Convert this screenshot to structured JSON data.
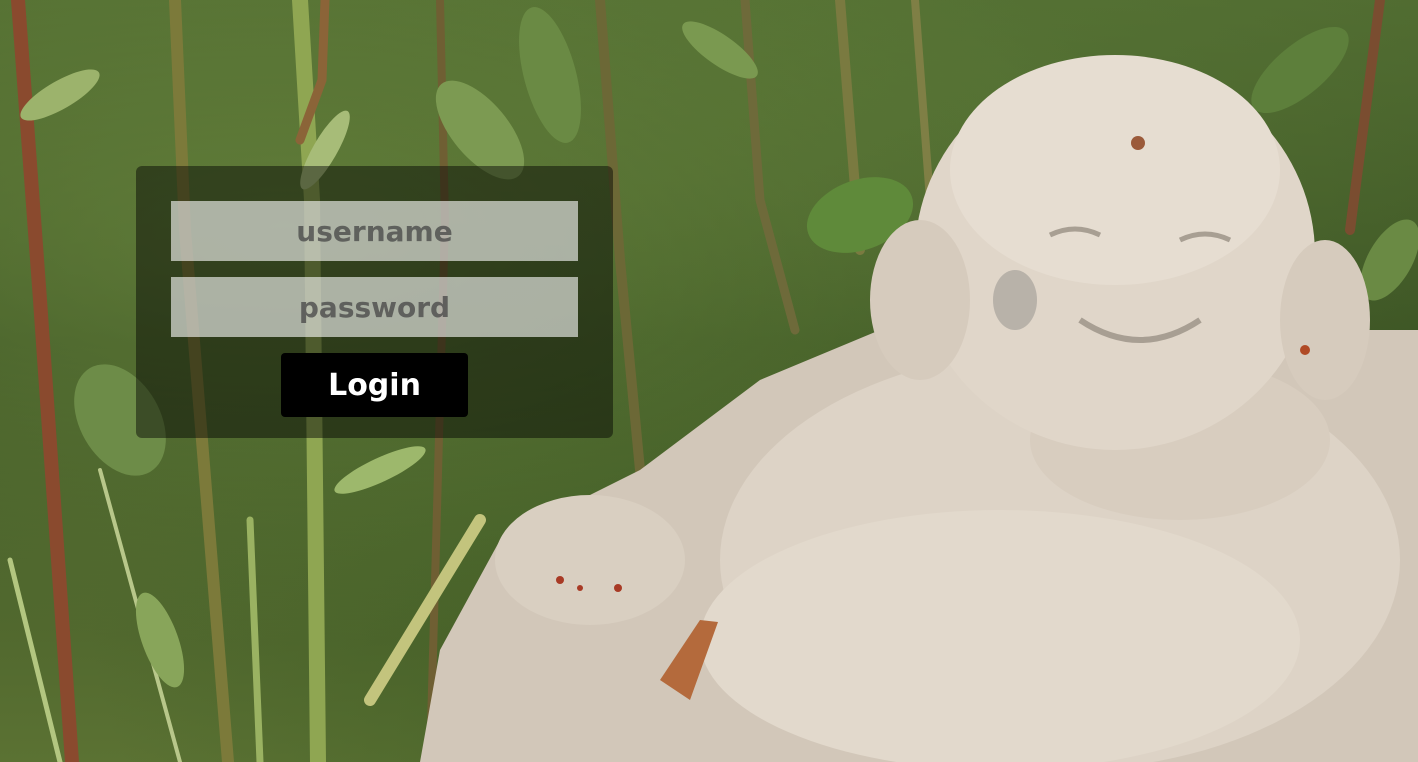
{
  "login": {
    "username_placeholder": "username",
    "password_placeholder": "password",
    "login_label": "Login"
  },
  "background": {
    "scene": "garden-buddha-photo",
    "colors": {
      "foliage": "#4f6a30",
      "statue": "#d9cfc2",
      "panel": "rgba(0,0,0,0.45)"
    }
  }
}
